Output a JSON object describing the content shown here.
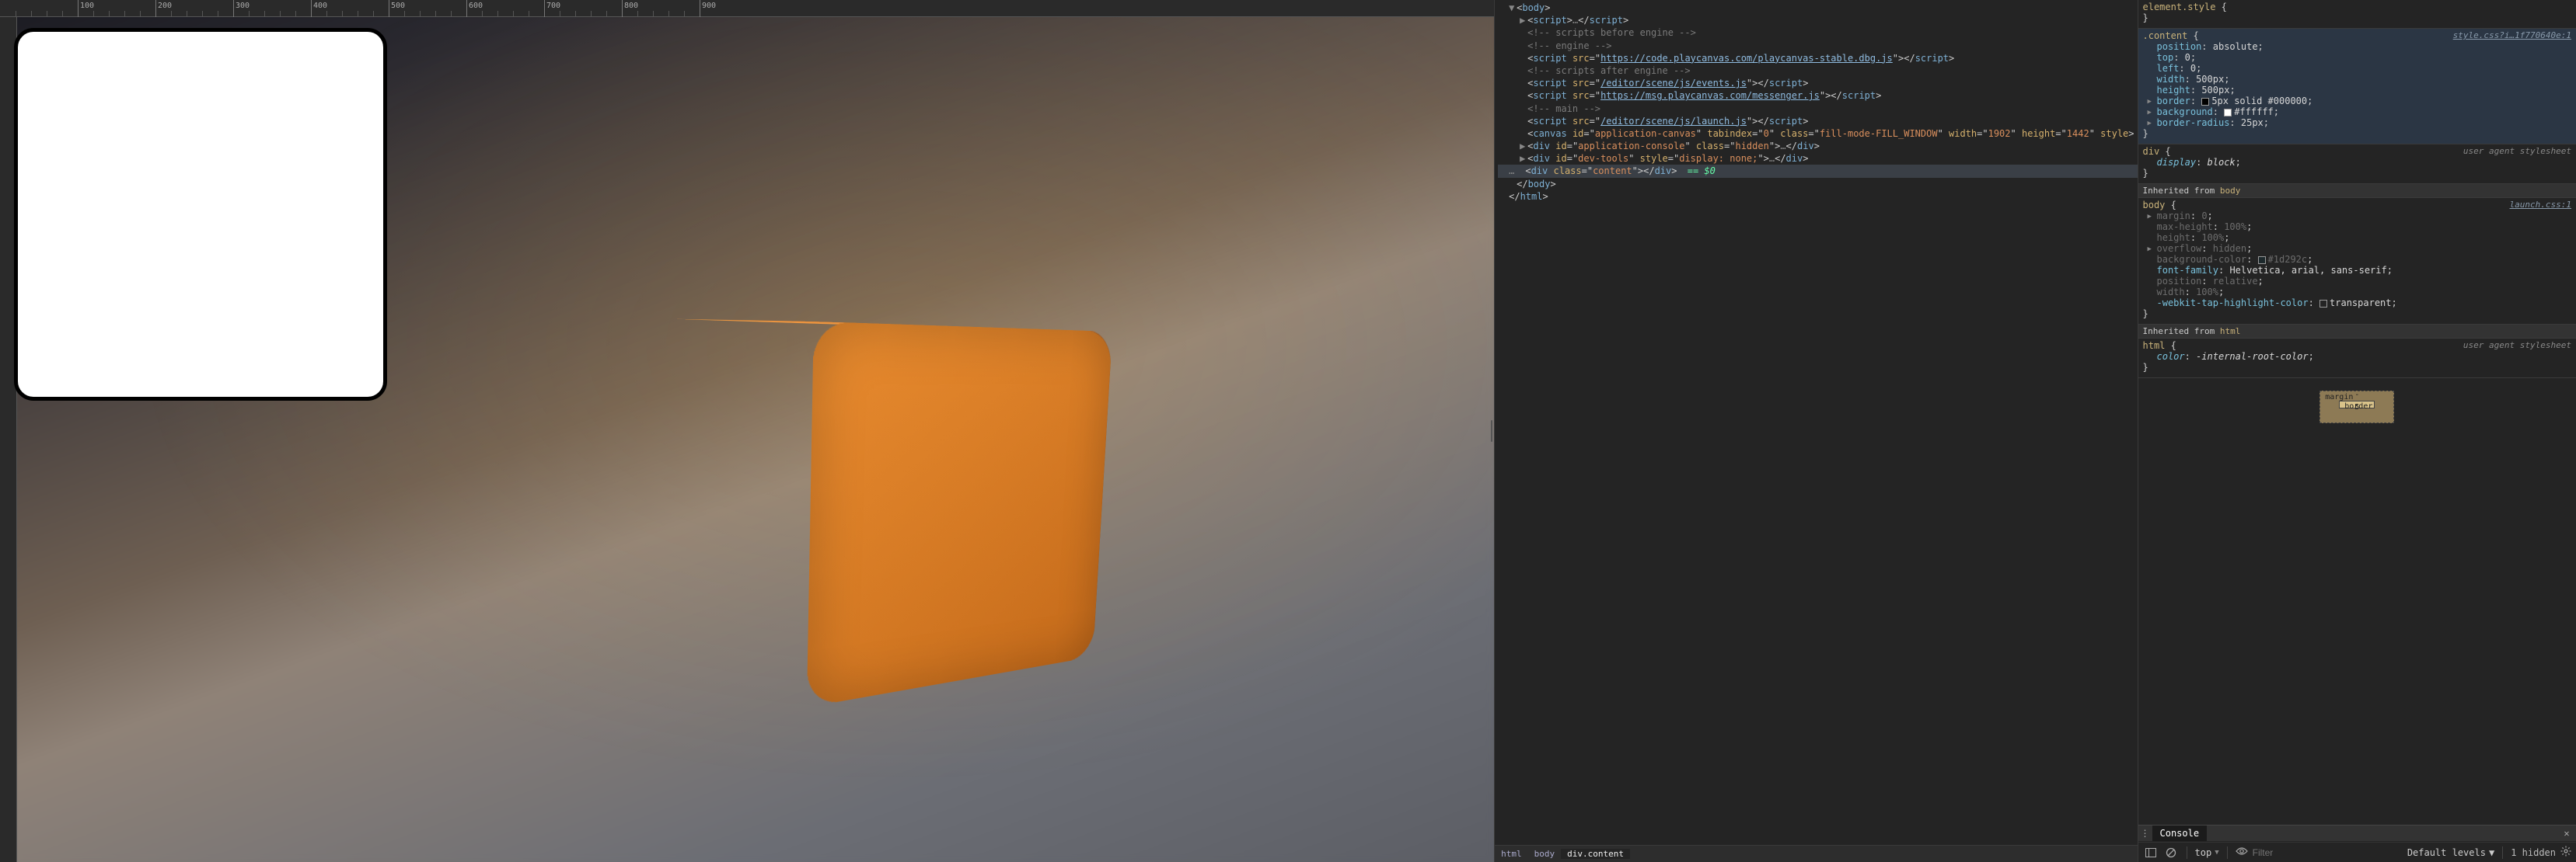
{
  "ruler": {
    "majors": [
      {
        "pos": 100,
        "label": "100"
      },
      {
        "pos": 200,
        "label": "200"
      },
      {
        "pos": 300,
        "label": "300"
      },
      {
        "pos": 400,
        "label": "400"
      },
      {
        "pos": 500,
        "label": "500"
      },
      {
        "pos": 600,
        "label": "600"
      },
      {
        "pos": 700,
        "label": "700"
      },
      {
        "pos": 800,
        "label": "800"
      },
      {
        "pos": 900,
        "label": "900"
      }
    ],
    "minor_step": 20
  },
  "dom": {
    "lines": [
      {
        "indent": 1,
        "arrow": "▼",
        "html": "<span class='punct'>&lt;</span><span class='tag'>body</span><span class='punct'>&gt;</span>"
      },
      {
        "indent": 2,
        "arrow": "▶",
        "html": "<span class='punct'>&lt;</span><span class='tag'>script</span><span class='punct'>&gt;</span><span class='ellipsis'>…</span><span class='punct'>&lt;/</span><span class='tag'>script</span><span class='punct'>&gt;</span>"
      },
      {
        "indent": 2,
        "html": "<span class='cm'>&lt;!-- scripts before engine --&gt;</span>"
      },
      {
        "indent": 2,
        "html": "<span class='cm'>&lt;!-- engine --&gt;</span>"
      },
      {
        "indent": 2,
        "html": "<span class='punct'>&lt;</span><span class='tag'>script</span> <span class='attr'>src</span>=\"<span class='link'>https://code.playcanvas.com/playcanvas-stable.dbg.js</span>\"<span class='punct'>&gt;&lt;/</span><span class='tag'>script</span><span class='punct'>&gt;</span>"
      },
      {
        "indent": 2,
        "html": "<span class='cm'>&lt;!-- scripts after engine --&gt;</span>"
      },
      {
        "indent": 2,
        "html": "<span class='punct'>&lt;</span><span class='tag'>script</span> <span class='attr'>src</span>=\"<span class='link'>/editor/scene/js/events.js</span>\"<span class='punct'>&gt;&lt;/</span><span class='tag'>script</span><span class='punct'>&gt;</span>"
      },
      {
        "indent": 2,
        "html": "<span class='punct'>&lt;</span><span class='tag'>script</span> <span class='attr'>src</span>=\"<span class='link'>https://msg.playcanvas.com/messenger.js</span>\"<span class='punct'>&gt;&lt;/</span><span class='tag'>script</span><span class='punct'>&gt;</span>"
      },
      {
        "indent": 2,
        "html": "<span class='cm'>&lt;!-- main --&gt;</span>"
      },
      {
        "indent": 2,
        "html": "<span class='punct'>&lt;</span><span class='tag'>script</span> <span class='attr'>src</span>=\"<span class='link'>/editor/scene/js/launch.js</span>\"<span class='punct'>&gt;&lt;/</span><span class='tag'>script</span><span class='punct'>&gt;</span>"
      },
      {
        "indent": 2,
        "html": "<span class='punct'>&lt;</span><span class='tag'>canvas</span> <span class='attr'>id</span>=\"<span class='val'>application-canvas</span>\" <span class='attr'>tabindex</span>=\"<span class='val'>0</span>\" <span class='attr'>class</span>=\"<span class='val'>fill-mode-FILL_WINDOW</span>\" <span class='attr'>width</span>=\"<span class='val'>1902</span>\" <span class='attr'>height</span>=\"<span class='val'>1442</span>\" <span class='attr'>style</span><span class='punct'>&gt;</span>"
      },
      {
        "indent": 2,
        "arrow": "▶",
        "html": "<span class='punct'>&lt;</span><span class='tag'>div</span> <span class='attr'>id</span>=\"<span class='val'>application-console</span>\" <span class='attr'>class</span>=\"<span class='val'>hidden</span>\"<span class='punct'>&gt;</span><span class='ellipsis'>…</span><span class='punct'>&lt;/</span><span class='tag'>div</span><span class='punct'>&gt;</span>"
      },
      {
        "indent": 2,
        "arrow": "▶",
        "html": "<span class='punct'>&lt;</span><span class='tag'>div</span> <span class='attr'>id</span>=\"<span class='val'>dev-tools</span>\" <span class='attr'>style</span>=\"<span class='val'>display: none;</span>\"<span class='punct'>&gt;</span><span class='ellipsis'>…</span><span class='punct'>&lt;/</span><span class='tag'>div</span><span class='punct'>&gt;</span>"
      },
      {
        "indent": 2,
        "selected": true,
        "prefix": "…",
        "html": "<span class='punct'>&lt;</span><span class='tag'>div</span> <span class='attr'>class</span>=\"<span class='val'>content</span>\"<span class='punct'>&gt;&lt;/</span><span class='tag'>div</span><span class='punct'>&gt;</span><span class='eqspan'> == $0</span>"
      },
      {
        "indent": 1,
        "html": "<span class='punct'>&lt;/</span><span class='tag'>body</span><span class='punct'>&gt;</span>"
      },
      {
        "indent": 0,
        "html": "<span class='punct'>&lt;/</span><span class='tag'>html</span><span class='punct'>&gt;</span>"
      }
    ],
    "breadcrumb": [
      "html",
      "body",
      "div.content"
    ]
  },
  "styles": {
    "element_style_label": "element.style",
    "rules": [
      {
        "selector": ".content",
        "source": "style.css?i…1f770640e:1",
        "selected": true,
        "props": [
          {
            "name": "position",
            "value": "absolute"
          },
          {
            "name": "top",
            "value": "0"
          },
          {
            "name": "left",
            "value": "0"
          },
          {
            "name": "width",
            "value": "500px"
          },
          {
            "name": "height",
            "value": "500px"
          },
          {
            "name": "border",
            "value": "5px solid #000000",
            "tri": true,
            "swatch": "#000000"
          },
          {
            "name": "background",
            "value": "#ffffff",
            "tri": true,
            "swatch": "#ffffff"
          },
          {
            "name": "border-radius",
            "value": "25px",
            "tri": true
          }
        ]
      },
      {
        "selector": "div",
        "ua": "user agent stylesheet",
        "props": [
          {
            "name": "display",
            "value": "block",
            "italic": true
          }
        ]
      }
    ],
    "inherited": [
      {
        "from": "body",
        "rules": [
          {
            "selector": "body",
            "source": "launch.css:1",
            "props": [
              {
                "name": "margin",
                "value": "0",
                "tri": true,
                "dim": true
              },
              {
                "name": "max-height",
                "value": "100%",
                "dim": true
              },
              {
                "name": "height",
                "value": "100%",
                "dim": true
              },
              {
                "name": "overflow",
                "value": "hidden",
                "tri": true,
                "dim": true
              },
              {
                "name": "background-color",
                "value": "#1d292c",
                "swatch": "#1d292c",
                "dim": true
              },
              {
                "name": "font-family",
                "value": "Helvetica, arial, sans-serif"
              },
              {
                "name": "position",
                "value": "relative",
                "dim": true
              },
              {
                "name": "width",
                "value": "100%",
                "dim": true
              },
              {
                "name": "-webkit-tap-highlight-color",
                "value": "transparent",
                "swatch": "transparent"
              }
            ]
          }
        ]
      },
      {
        "from": "html",
        "rules": [
          {
            "selector": "html",
            "ua": "user agent stylesheet",
            "props": [
              {
                "name": "color",
                "value": "-internal-root-color",
                "italic": true
              }
            ]
          }
        ]
      }
    ],
    "box_model": {
      "margin_label": "margin",
      "margin_top": "-",
      "border_label": "border",
      "border_top": "5"
    }
  },
  "console": {
    "tab_label": "Console",
    "context": "top",
    "filter_placeholder": "Filter",
    "levels_label": "Default levels",
    "hidden_label": "1 hidden"
  },
  "inherited_label": "Inherited from"
}
